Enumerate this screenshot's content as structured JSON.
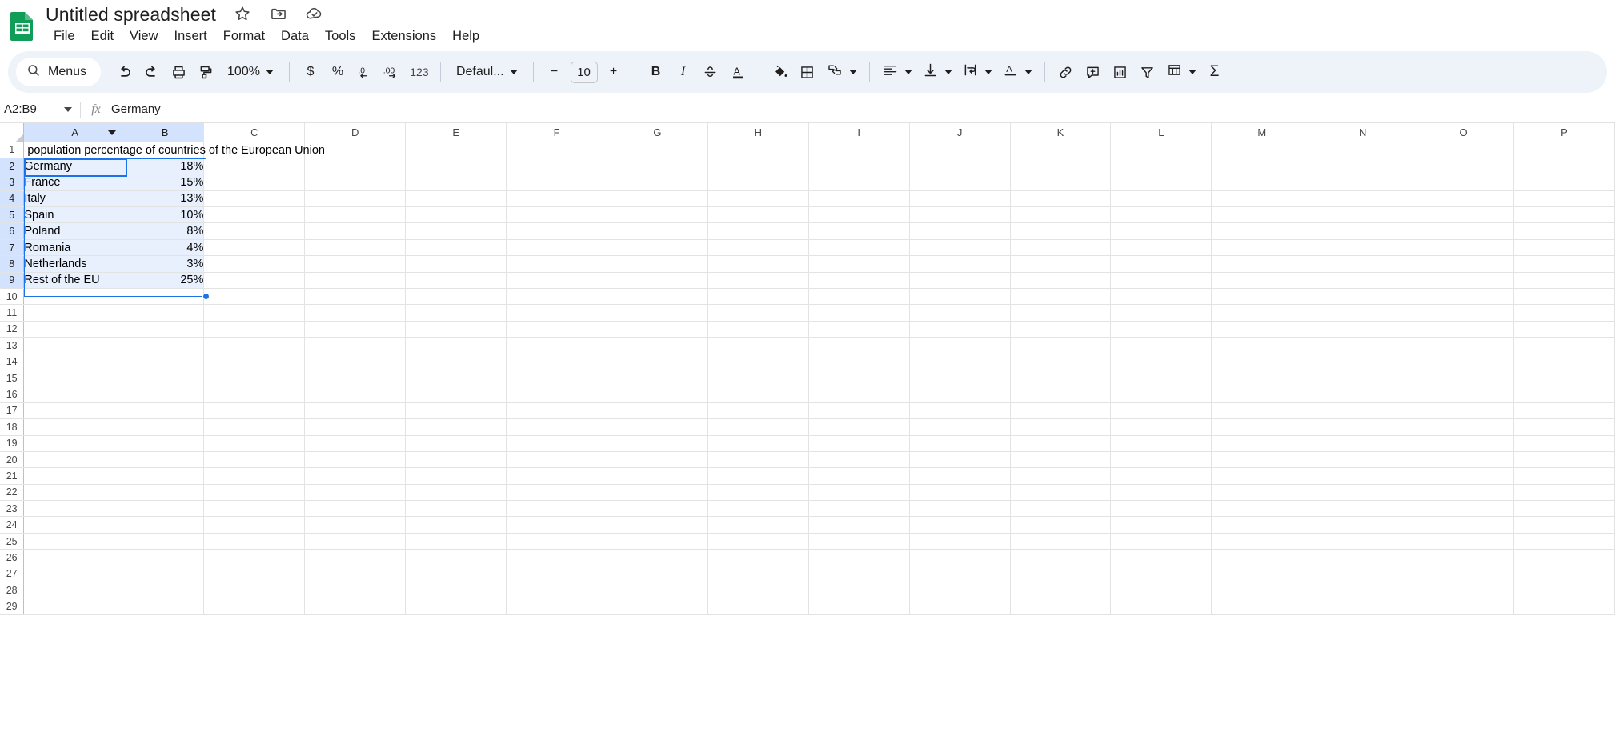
{
  "app": {
    "doc_title": "Untitled spreadsheet",
    "logo_icon": "sheets-logo-icon",
    "title_icons": [
      {
        "name": "star-icon",
        "label": "Star"
      },
      {
        "name": "move-to-folder-icon",
        "label": "Move"
      },
      {
        "name": "cloud-saved-icon",
        "label": "Saved to Drive"
      }
    ],
    "menus": [
      "File",
      "Edit",
      "View",
      "Insert",
      "Format",
      "Data",
      "Tools",
      "Extensions",
      "Help"
    ]
  },
  "toolbar": {
    "menus_label": "Menus",
    "menus_icon": "search-icon",
    "zoom_value": "100%",
    "font_name": "Defaul...",
    "font_size": "10",
    "decrease_font_label": "−",
    "increase_font_label": "+",
    "bold_label": "B",
    "italic_label": "I",
    "currency_label": "$",
    "percent_label": "%",
    "dec_decimal_label": ".0",
    "inc_decimal_label": ".00",
    "number_format_label": "123",
    "sum_label": "Σ",
    "items": [
      {
        "name": "undo-icon"
      },
      {
        "name": "redo-icon"
      },
      {
        "name": "print-icon"
      },
      {
        "name": "paint-format-icon"
      },
      {
        "name": "strikethrough-icon"
      },
      {
        "name": "text-color-icon"
      },
      {
        "name": "fill-color-icon"
      },
      {
        "name": "borders-icon"
      },
      {
        "name": "merge-cells-icon"
      },
      {
        "name": "horizontal-align-icon"
      },
      {
        "name": "vertical-align-icon"
      },
      {
        "name": "text-wrapping-icon"
      },
      {
        "name": "text-rotation-icon"
      },
      {
        "name": "insert-link-icon"
      },
      {
        "name": "insert-comment-icon"
      },
      {
        "name": "insert-chart-icon"
      },
      {
        "name": "create-filter-icon"
      },
      {
        "name": "functions-icon"
      }
    ]
  },
  "formula_bar": {
    "name_box": "A2:B9",
    "fx_label": "fx",
    "formula_value": "Germany"
  },
  "grid": {
    "columns": [
      "A",
      "B",
      "C",
      "D",
      "E",
      "F",
      "G",
      "H",
      "I",
      "J",
      "K",
      "L",
      "M",
      "N",
      "O",
      "P"
    ],
    "selected_columns": [
      "A",
      "B"
    ],
    "rows": [
      1,
      2,
      3,
      4,
      5,
      6,
      7,
      8,
      9,
      10,
      11,
      12,
      13,
      14,
      15,
      16,
      17,
      18,
      19,
      20,
      21,
      22,
      23,
      24,
      25,
      26,
      27,
      28,
      29
    ],
    "selected_rows": [
      2,
      3,
      4,
      5,
      6,
      7,
      8,
      9
    ],
    "selection_range": "A2:B9",
    "active_cell": "A2",
    "cells": [
      {
        "row": 1,
        "col": "A",
        "value": "population percentage of countries of the European Union",
        "overflow": true,
        "align": "left"
      },
      {
        "row": 2,
        "col": "A",
        "value": "Germany",
        "align": "left"
      },
      {
        "row": 2,
        "col": "B",
        "value": "18%",
        "align": "right"
      },
      {
        "row": 3,
        "col": "A",
        "value": "France",
        "align": "left"
      },
      {
        "row": 3,
        "col": "B",
        "value": "15%",
        "align": "right"
      },
      {
        "row": 4,
        "col": "A",
        "value": "Italy",
        "align": "left"
      },
      {
        "row": 4,
        "col": "B",
        "value": "13%",
        "align": "right"
      },
      {
        "row": 5,
        "col": "A",
        "value": "Spain",
        "align": "left"
      },
      {
        "row": 5,
        "col": "B",
        "value": "10%",
        "align": "right"
      },
      {
        "row": 6,
        "col": "A",
        "value": "Poland",
        "align": "left"
      },
      {
        "row": 6,
        "col": "B",
        "value": "8%",
        "align": "right"
      },
      {
        "row": 7,
        "col": "A",
        "value": "Romania",
        "align": "left"
      },
      {
        "row": 7,
        "col": "B",
        "value": "4%",
        "align": "right"
      },
      {
        "row": 8,
        "col": "A",
        "value": "Netherlands",
        "align": "left"
      },
      {
        "row": 8,
        "col": "B",
        "value": "3%",
        "align": "right"
      },
      {
        "row": 9,
        "col": "A",
        "value": "Rest of the EU",
        "align": "left"
      },
      {
        "row": 9,
        "col": "B",
        "value": "25%",
        "align": "right"
      }
    ]
  },
  "colors": {
    "accent": "#1a73e8",
    "selection_fill": "#e8f0fe",
    "header_selected": "#d3e3fd",
    "toolbar_bg": "#eef2f9",
    "sheets_green": "#0f9d58"
  }
}
